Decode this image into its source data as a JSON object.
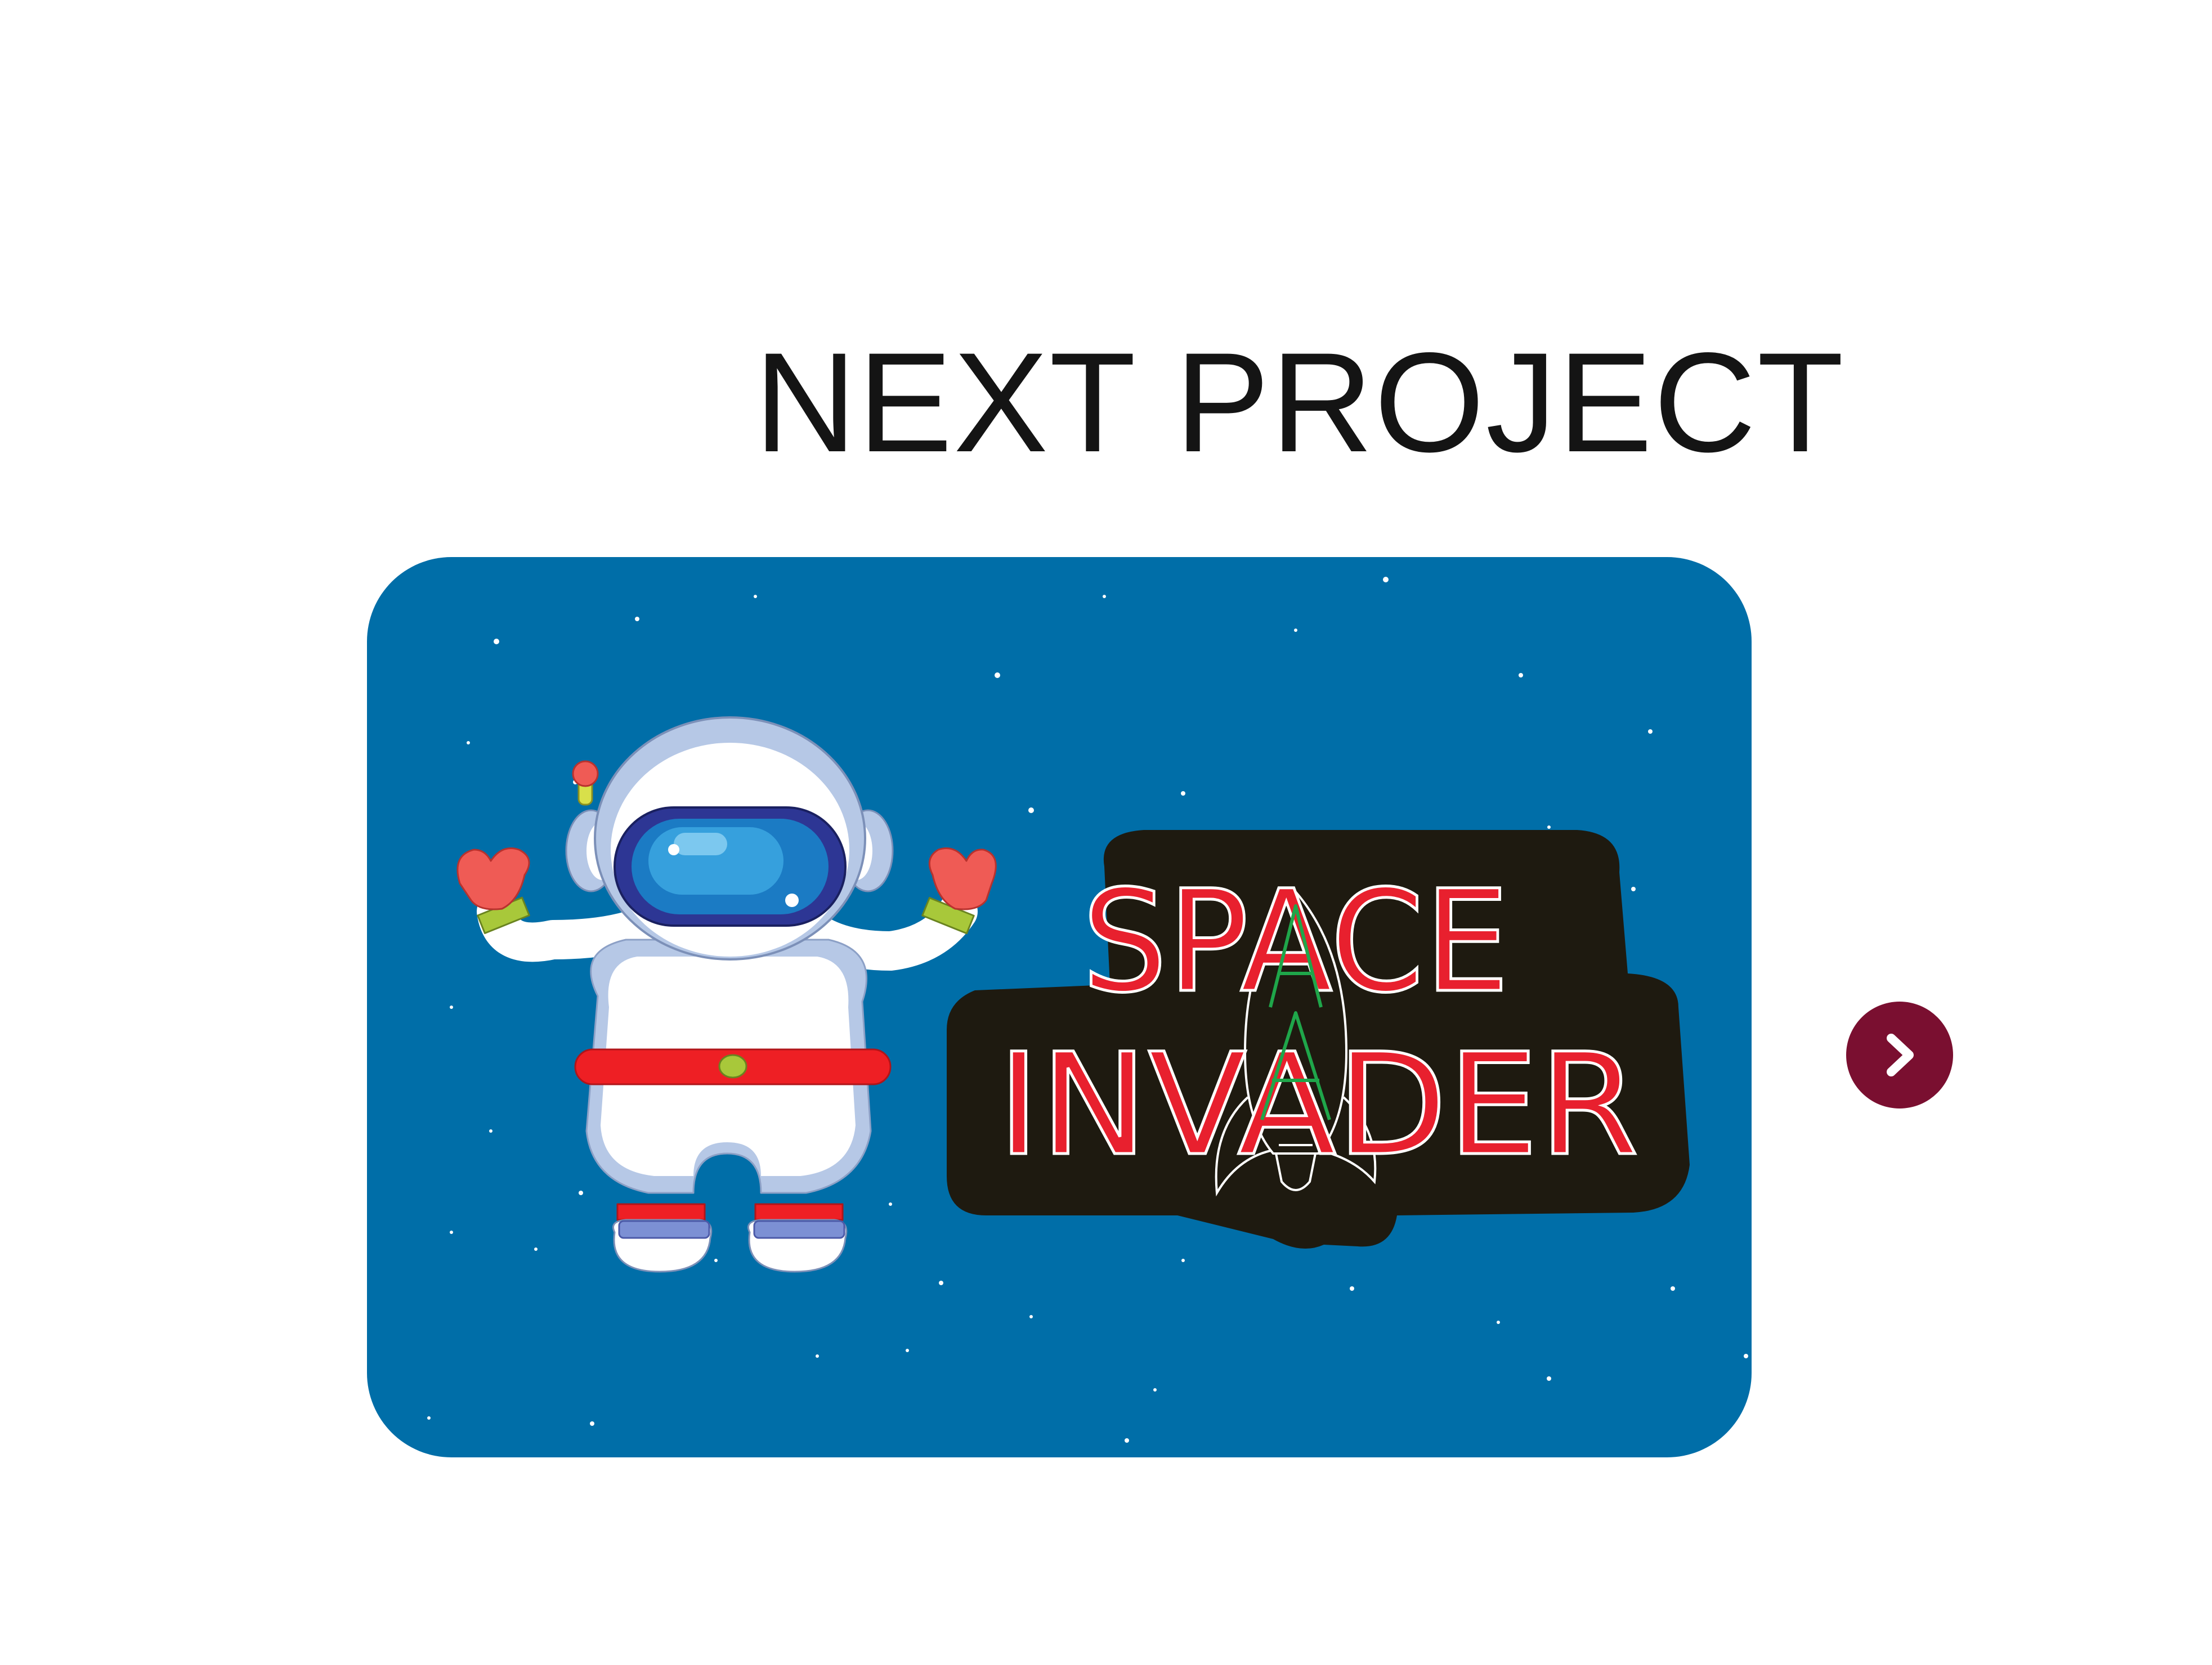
{
  "heading": "NEXT PROJECT",
  "project": {
    "title_line1": "SPACE",
    "title_line2": "INVADER"
  },
  "next_button": {
    "icon": "chevron-right-icon"
  },
  "colors": {
    "card_background": "#006ea8",
    "title_red": "#e8202e",
    "title_outline": "#1e1a10",
    "rocket_green": "#1fa64a",
    "button": "#7a0f30",
    "heading_text": "#141414"
  }
}
